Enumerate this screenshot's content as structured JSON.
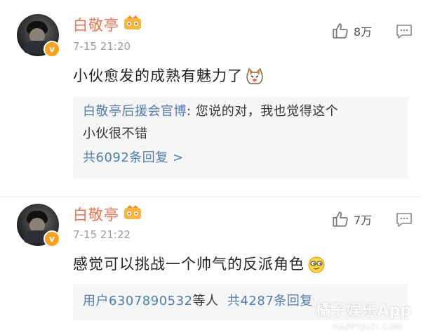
{
  "comments": [
    {
      "username": "白敬亭",
      "time": "7-15 21:20",
      "likes": "8万",
      "content": "小伙愈发的成熟有魅力了",
      "emoji": "cat-face-emoji",
      "reply": {
        "author": "白敬亭后援会官博",
        "text_line1": ": 您说的对，我也觉得这个",
        "text_line2": "小伙很不错",
        "more": "共6092条回复 >"
      }
    },
    {
      "username": "白敬亭",
      "time": "7-15 21:22",
      "likes": "7万",
      "content": "感觉可以挑战一个帅气的反派角色",
      "emoji": "smirk-face-emoji",
      "reply": {
        "users": "用户6307890532",
        "suffix": "等人",
        "more": "共4287条回复"
      }
    }
  ],
  "watermark": {
    "text": "橘子娱乐App",
    "sub": "HAPPYJUZI.COM"
  },
  "colors": {
    "username": "#eb7350",
    "link": "#507daf",
    "time": "#9b9b9b",
    "reply_bg": "#f6f6f6",
    "badge": "#f7a11c"
  }
}
